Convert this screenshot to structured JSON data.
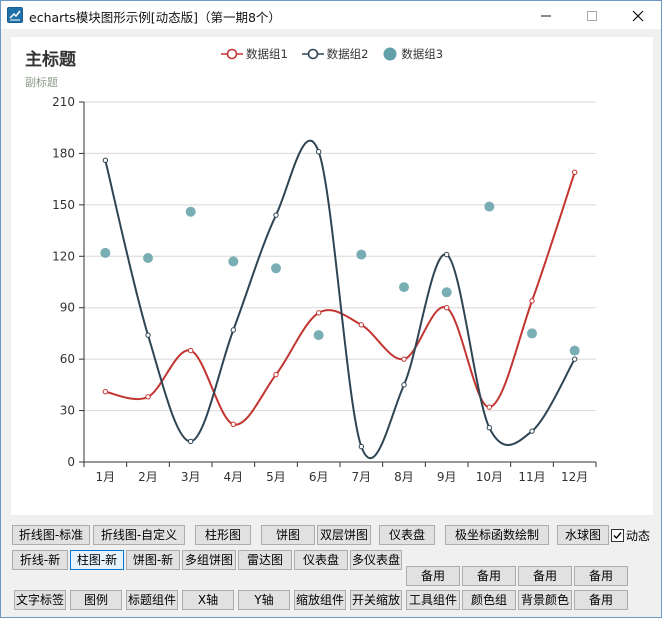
{
  "window": {
    "title": "echarts模块图形示例[动态版]（第一期8个）",
    "controls": {
      "minimize": "minimize-icon",
      "maximize": "maximize-icon",
      "close": "close-icon"
    }
  },
  "chart_header": {
    "title": "主标题",
    "subtitle": "副标题"
  },
  "chart_data": {
    "type": "line",
    "categories": [
      "1月",
      "2月",
      "3月",
      "4月",
      "5月",
      "6月",
      "7月",
      "8月",
      "9月",
      "10月",
      "11月",
      "12月"
    ],
    "ylim": [
      0,
      210
    ],
    "yticks": [
      0,
      30,
      60,
      90,
      120,
      150,
      180,
      210
    ],
    "grid": true,
    "legend_position": "top",
    "series": [
      {
        "name": "数据组1",
        "type": "line",
        "smooth": true,
        "color": "#c23531",
        "values": [
          41,
          38,
          65,
          22,
          51,
          87,
          80,
          60,
          90,
          32,
          94,
          169
        ]
      },
      {
        "name": "数据组2",
        "type": "line",
        "smooth": true,
        "color": "#2f4554",
        "values": [
          176,
          74,
          12,
          77,
          144,
          181,
          9,
          45,
          121,
          20,
          18,
          60
        ]
      },
      {
        "name": "数据组3",
        "type": "scatter",
        "color": "#61a0a8",
        "values": [
          122,
          119,
          146,
          117,
          113,
          74,
          121,
          102,
          99,
          149,
          75,
          65
        ]
      }
    ]
  },
  "buttons": {
    "row1": [
      "折线图-标准",
      "折线图-自定义",
      "柱形图",
      "饼图",
      "双层饼图",
      "仪表盘",
      "极坐标函数绘制",
      "水球图"
    ],
    "row2": [
      "折线-新",
      "柱图-新",
      "饼图-新",
      "多组饼图",
      "雷达图",
      "仪表盘",
      "多仪表盘"
    ],
    "row3": [
      "备用",
      "备用",
      "备用",
      "备用"
    ],
    "row4": [
      "文字标签",
      "图例",
      "标题组件",
      "X轴",
      "Y轴",
      "缩放组件",
      "开关缩放",
      "工具组件",
      "颜色组",
      "背景颜色",
      "备用"
    ]
  },
  "dynamic_checkbox": {
    "label": "动态",
    "checked": true
  }
}
